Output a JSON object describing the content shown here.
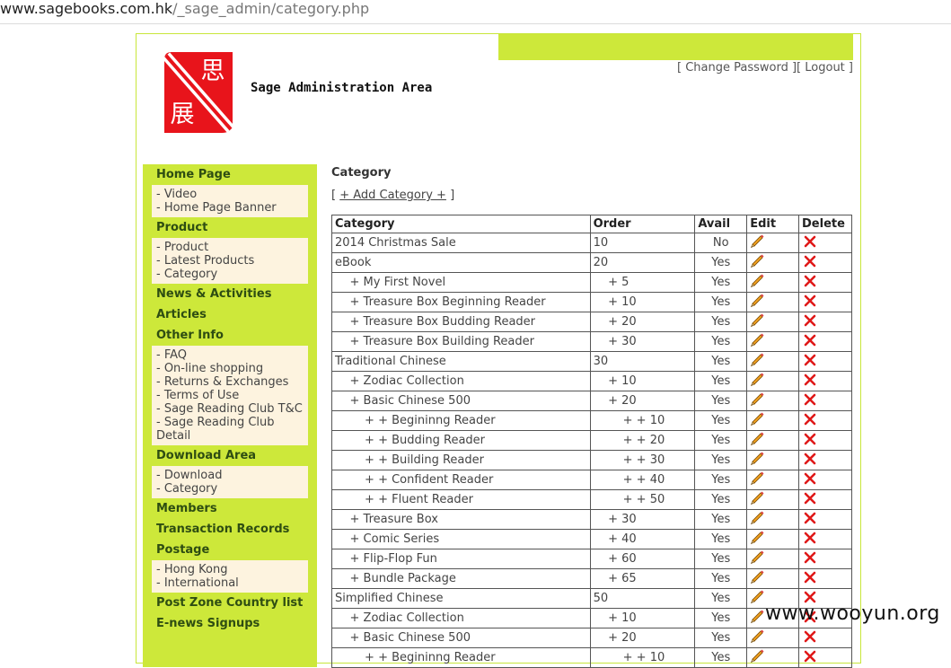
{
  "browser": {
    "url_host": "www.sagebooks.com.hk",
    "url_path": "/_sage_admin/category.php"
  },
  "header": {
    "title": "Sage Administration Area",
    "links": {
      "open": "[ ",
      "change_password": "Change Password",
      "mid": " ][ ",
      "logout": "Logout",
      "close": " ]"
    },
    "logo_chars": [
      "思",
      "展"
    ],
    "colors": {
      "accent": "#cde83a",
      "logo_red": "#e8141b"
    }
  },
  "sidebar": {
    "sections": [
      {
        "label": "Home Page",
        "items": [
          "- Video",
          "- Home Page Banner"
        ]
      },
      {
        "label": "Product",
        "items": [
          "- Product",
          "- Latest Products",
          "- Category"
        ]
      },
      {
        "label": "News & Activities",
        "items": []
      },
      {
        "label": "Articles",
        "items": []
      },
      {
        "label": "Other Info",
        "items": [
          "- FAQ",
          "- On-line shopping",
          "- Returns & Exchanges",
          "- Terms of Use",
          "- Sage Reading Club T&C",
          "- Sage Reading Club Detail"
        ]
      },
      {
        "label": "Download Area",
        "items": [
          "- Download",
          "- Category"
        ]
      },
      {
        "label": "Members",
        "items": []
      },
      {
        "label": "Transaction Records",
        "items": []
      },
      {
        "label": "Postage",
        "items": [
          "- Hong Kong",
          "- International"
        ]
      },
      {
        "label": "Post Zone Country list",
        "items": []
      },
      {
        "label": "E-news Signups",
        "items": []
      }
    ]
  },
  "main": {
    "title": "Category",
    "add_link": {
      "open": "[ ",
      "label": "+ Add Category +",
      "close": " ]"
    },
    "table": {
      "headers": [
        "Category",
        "Order",
        "Avail",
        "Edit",
        "Delete"
      ],
      "rows": [
        {
          "name": "2014 Christmas Sale",
          "order": "10",
          "avail": "No"
        },
        {
          "name": "eBook",
          "order": "20",
          "avail": "Yes"
        },
        {
          "name": "    + My First Novel",
          "order": "    + 5",
          "avail": "Yes"
        },
        {
          "name": "    + Treasure Box Beginning Reader",
          "order": "    + 10",
          "avail": "Yes"
        },
        {
          "name": "    + Treasure Box Budding Reader",
          "order": "    + 20",
          "avail": "Yes"
        },
        {
          "name": "    + Treasure Box Building Reader",
          "order": "    + 30",
          "avail": "Yes"
        },
        {
          "name": "Traditional Chinese",
          "order": "30",
          "avail": "Yes"
        },
        {
          "name": "    + Zodiac Collection",
          "order": "    + 10",
          "avail": "Yes"
        },
        {
          "name": "    + Basic Chinese 500",
          "order": "    + 20",
          "avail": "Yes"
        },
        {
          "name": "        + + Begininng Reader",
          "order": "        + + 10",
          "avail": "Yes"
        },
        {
          "name": "        + + Budding Reader",
          "order": "        + + 20",
          "avail": "Yes"
        },
        {
          "name": "        + + Building Reader",
          "order": "        + + 30",
          "avail": "Yes"
        },
        {
          "name": "        + + Confident Reader",
          "order": "        + + 40",
          "avail": "Yes"
        },
        {
          "name": "        + + Fluent Reader",
          "order": "        + + 50",
          "avail": "Yes"
        },
        {
          "name": "    + Treasure Box",
          "order": "    + 30",
          "avail": "Yes"
        },
        {
          "name": "    + Comic Series",
          "order": "    + 40",
          "avail": "Yes"
        },
        {
          "name": "    + Flip-Flop Fun",
          "order": "    + 60",
          "avail": "Yes"
        },
        {
          "name": "    + Bundle Package",
          "order": "    + 65",
          "avail": "Yes"
        },
        {
          "name": "Simplified Chinese",
          "order": "50",
          "avail": "Yes"
        },
        {
          "name": "    + Zodiac Collection",
          "order": "    + 10",
          "avail": "Yes"
        },
        {
          "name": "    + Basic Chinese 500",
          "order": "    + 20",
          "avail": "Yes"
        },
        {
          "name": "        + + Begininng Reader",
          "order": "        + + 10",
          "avail": "Yes"
        }
      ]
    }
  },
  "watermark": "www.wooyun.org"
}
